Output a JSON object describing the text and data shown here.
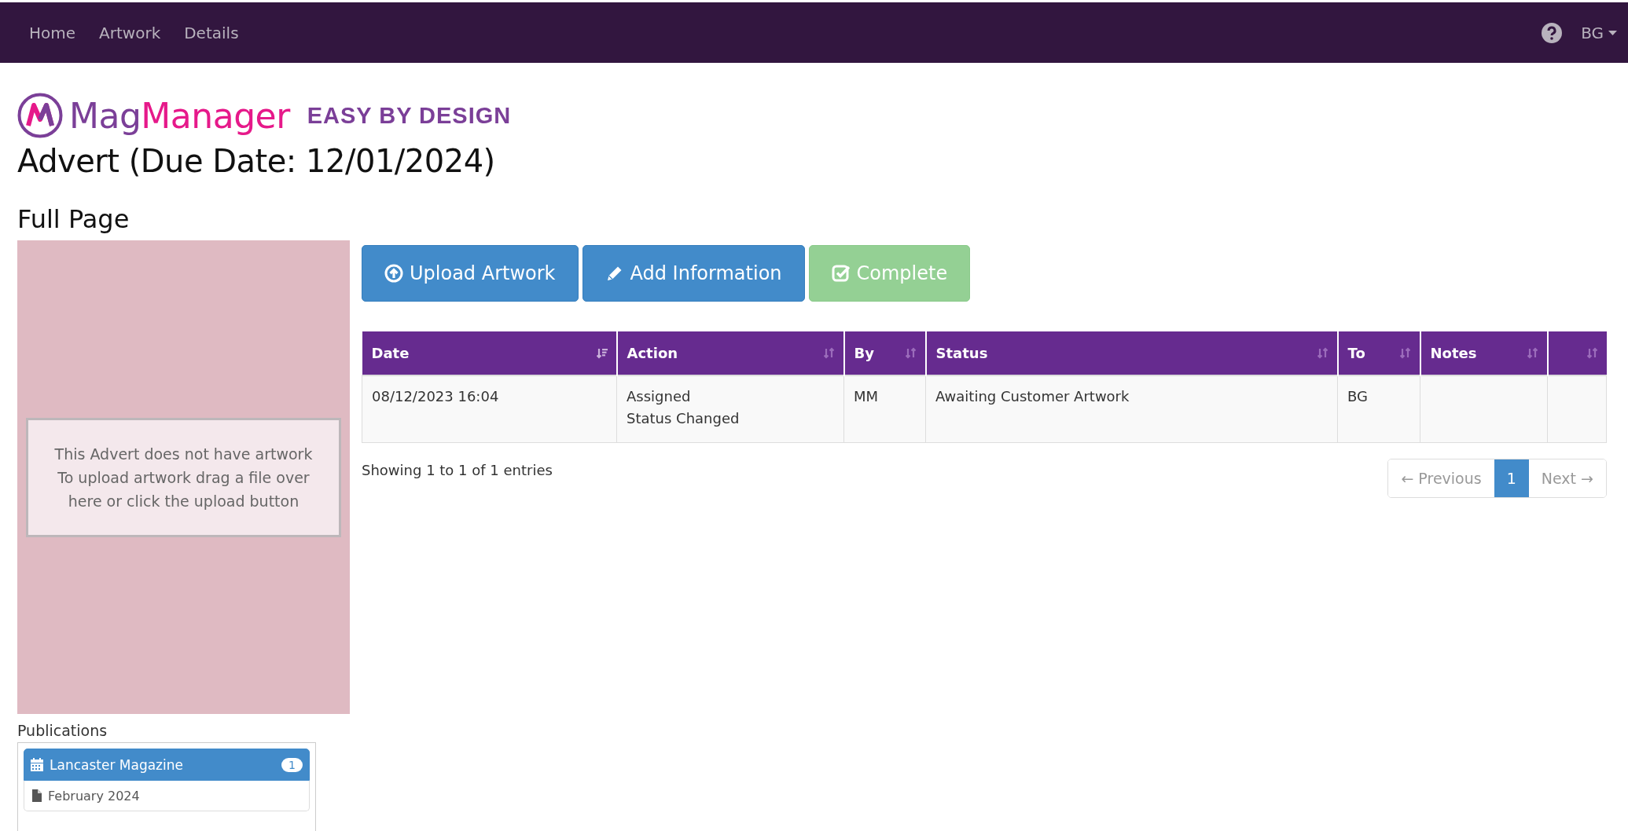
{
  "navbar": {
    "links": [
      {
        "label": "Home"
      },
      {
        "label": "Artwork"
      },
      {
        "label": "Details"
      }
    ],
    "user": "BG"
  },
  "logo": {
    "name_start": "Mag",
    "name_end": "Manager",
    "tagline": "EASY BY DESIGN"
  },
  "title": "Advert (Due Date: 12/01/2024)",
  "subtitle": "Full Page",
  "artwork_panel": {
    "lines": [
      "This Advert does not have artwork",
      "To upload artwork drag a file over here or click the upload button"
    ]
  },
  "publications": {
    "heading": "Publications",
    "items": [
      {
        "label": "Lancaster Magazine",
        "count": "1",
        "selected": true,
        "children": [
          {
            "label": "February 2024"
          }
        ]
      }
    ]
  },
  "actions": [
    {
      "kind": "upload",
      "label": "Upload Artwork",
      "disabled": false
    },
    {
      "kind": "edit",
      "label": "Add Information",
      "disabled": false
    },
    {
      "kind": "complete",
      "label": "Complete",
      "disabled": true
    }
  ],
  "table": {
    "columns": [
      {
        "label": "Date",
        "sorted": true
      },
      {
        "label": "Action",
        "sorted": false
      },
      {
        "label": "By",
        "sorted": false
      },
      {
        "label": "Status",
        "sorted": false
      },
      {
        "label": "To",
        "sorted": false
      },
      {
        "label": "Notes",
        "sorted": false
      },
      {
        "sorted": false
      }
    ],
    "rows": [
      {
        "cells": [
          "08/12/2023 16:04",
          "Assigned\nStatus Changed",
          "MM",
          "Awaiting Customer Artwork",
          "BG"
        ]
      }
    ]
  },
  "info": "Showing 1 to 1 of 1 entries",
  "pagination": {
    "previous": {
      "label": "← Previous",
      "disabled": true
    },
    "pages": [
      {
        "label": "1",
        "selected": true
      }
    ],
    "next": {
      "label": "Next →",
      "disabled": true
    }
  }
}
